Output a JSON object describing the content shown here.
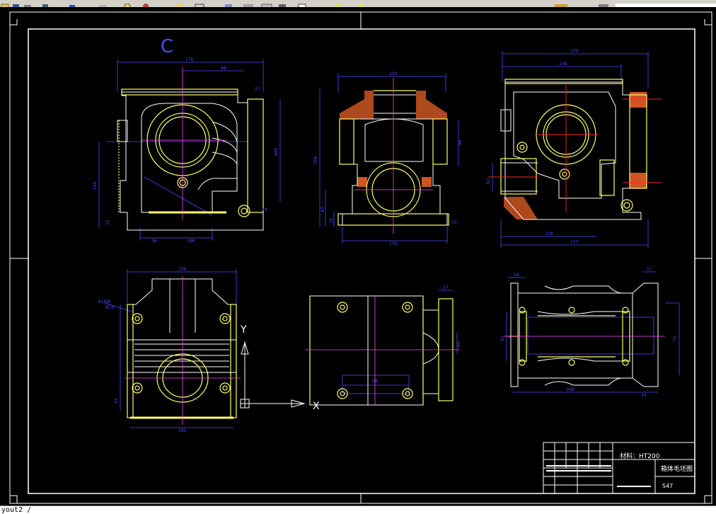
{
  "toolbar": {
    "buttons": [
      "open-icon",
      "save-icon",
      "print-icon",
      "undo-icon",
      "redo-icon",
      "pan-icon",
      "zoom-icon",
      "zoom-window-icon",
      "zoom-previous-icon",
      "text-icon",
      "properties-icon",
      "layer-icon",
      "block-icon",
      "table-icon",
      "dropdown-icon",
      "snap-icon",
      "render-icon",
      "help-icon"
    ]
  },
  "drawing": {
    "view_label": "C",
    "dims": {
      "v1_top_a": "170",
      "v1_top_b": "98",
      "v1_right": "17",
      "v1_right_vert": "φ60",
      "v1_left": "160",
      "v1_bottom_a": "36",
      "v1_bottom_b": "188",
      "v1_small_a": "15",
      "v1_small_b": "14",
      "v2_top": "130",
      "v2_left": "166",
      "v2_right": "86",
      "v2_low_a": "43",
      "v2_low_b": "18",
      "v2_bottom": "174",
      "v2_small": "15",
      "v3_top_a": "170",
      "v3_top_b": "138",
      "v3_left": "62",
      "v3_bottom_a": "118",
      "v3_bottom_b": "177",
      "v4_top": "130",
      "v4_note": "4×M8",
      "v4_note2": "深16",
      "v4_left": "55",
      "v4_bottom": "160",
      "v5_top": "17",
      "v5_right": "65",
      "v5_mid": "98",
      "v6_top_a": "18",
      "v6_top_b": "17",
      "v6_right": "75",
      "v6_left": "42",
      "v6_bottom_a": "168",
      "v6_bottom_b": "24"
    },
    "ucs": {
      "y_label": "Y",
      "x_label": "X"
    }
  },
  "title_block": {
    "material": "材料：HT200",
    "drawing_name": "箱体毛坯图",
    "scale": "S47"
  },
  "command_line": {
    "text": "yout2 /"
  },
  "colors": {
    "frame": "#ffffff",
    "outline": "#ffff66",
    "dimension": "#4a4aff",
    "center": "#ff44ff",
    "section": "#cc5522",
    "cross": "#ff2222"
  }
}
